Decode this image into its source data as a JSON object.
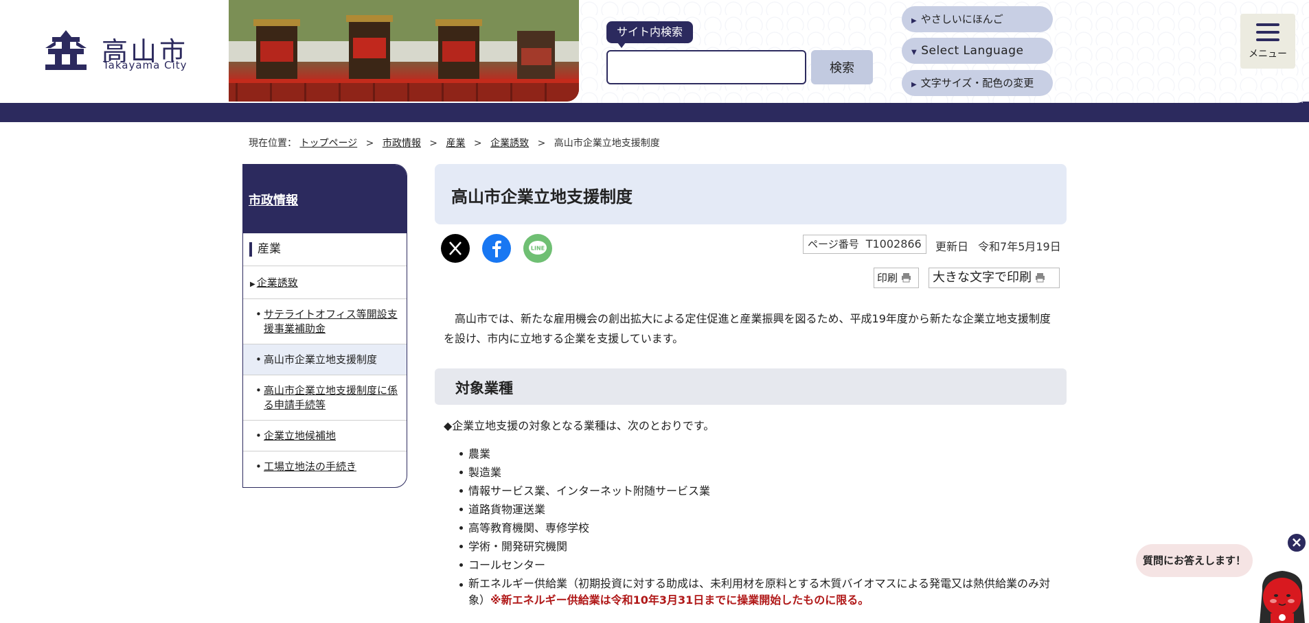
{
  "header": {
    "logo_jp": "高山市",
    "logo_en": "Takayama City",
    "search_label": "サイト内検索",
    "search_placeholder": "",
    "search_button": "検索",
    "easy_japanese": "やさしいにほんご",
    "select_language": "Select Language",
    "font_color": "文字サイズ・配色の変更",
    "menu_label": "メニュー"
  },
  "breadcrumb": {
    "prefix": "現在位置：",
    "items": [
      "トップページ",
      "市政情報",
      "産業",
      "企業誘致"
    ],
    "current": "高山市企業立地支援制度",
    "separator": ">"
  },
  "sidebar": {
    "heading": "市政情報",
    "category": "産業",
    "subcategory": "企業誘致",
    "items": [
      "サテライトオフィス等開設支援事業補助金",
      "高山市企業立地支援制度",
      "高山市企業立地支援制度に係る申請手続等",
      "企業立地候補地",
      "工場立地法の手続き"
    ]
  },
  "main": {
    "title": "高山市企業立地支援制度",
    "share": {
      "x": "x-icon",
      "facebook": "facebook-icon",
      "line": "LINE"
    },
    "page_number_label": "ページ番号",
    "page_number": "T1002866",
    "updated_label": "更新日",
    "updated_date": "令和7年5月19日",
    "print": "印刷",
    "print_large": "大きな文字で印刷",
    "intro": "高山市では、新たな雇用機会の創出拡大による定住促進と産業振興を図るため、平成19年度から新たな企業立地支援制度を設け、市内に立地する企業を支援しています。",
    "section_title": "対象業種",
    "list_lead": "◆企業立地支援の対象となる業種は、次のとおりです。",
    "industries": [
      "農業",
      "製造業",
      "情報サービス業、インターネット附随サービス業",
      "道路貨物運送業",
      "高等教育機関、専修学校",
      "学術・開発研究機関",
      "コールセンター"
    ],
    "energy_item": "新エネルギー供給業（初期投資に対する助成は、未利用材を原料とする木質バイオマスによる発電又は熱供給業のみ対象）",
    "energy_note": "※新エネルギー供給業は令和10年3月31日までに操業開始したものに限る。"
  },
  "chat": {
    "bubble": "質問にお答えします！",
    "close": "×"
  },
  "colors": {
    "navy": "#2c2a5e",
    "title_bg": "#e4eaf6",
    "note_red": "#b01818"
  }
}
